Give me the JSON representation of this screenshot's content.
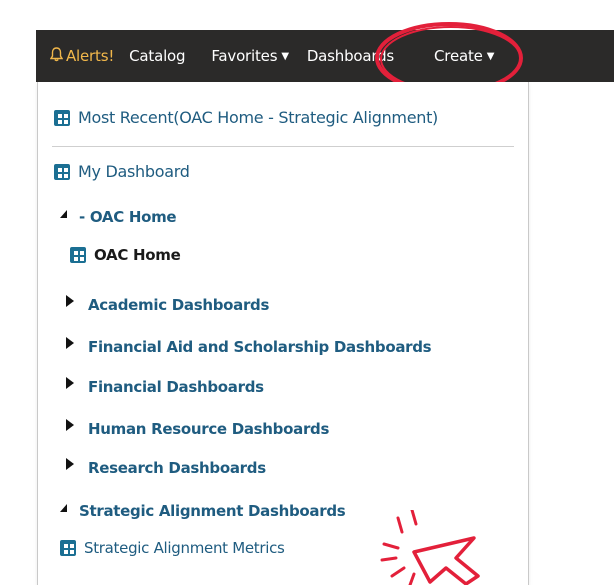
{
  "topnav": {
    "alerts_label": "Alerts!",
    "catalog_label": "Catalog",
    "favorites_label": "Favorites",
    "dashboards_label": "Dashboards",
    "create_label": "Create"
  },
  "menu": {
    "most_recent": "Most Recent(OAC Home - Strategic Alignment)",
    "my_dashboard": "My Dashboard",
    "oac_home_folder": "- OAC Home",
    "oac_home_item": "OAC Home",
    "folders": [
      "Academic Dashboards",
      "Financial Aid and Scholarship Dashboards",
      "Financial Dashboards",
      "Human Resource Dashboards",
      "Research Dashboards"
    ],
    "strategic_folder": "Strategic Alignment Dashboards",
    "strategic_item": "Strategic Alignment Metrics"
  },
  "colors": {
    "topbar": "#2b2a29",
    "link": "#1f5c80",
    "highlight": "#e3203a",
    "alerts": "#f2b84b"
  }
}
